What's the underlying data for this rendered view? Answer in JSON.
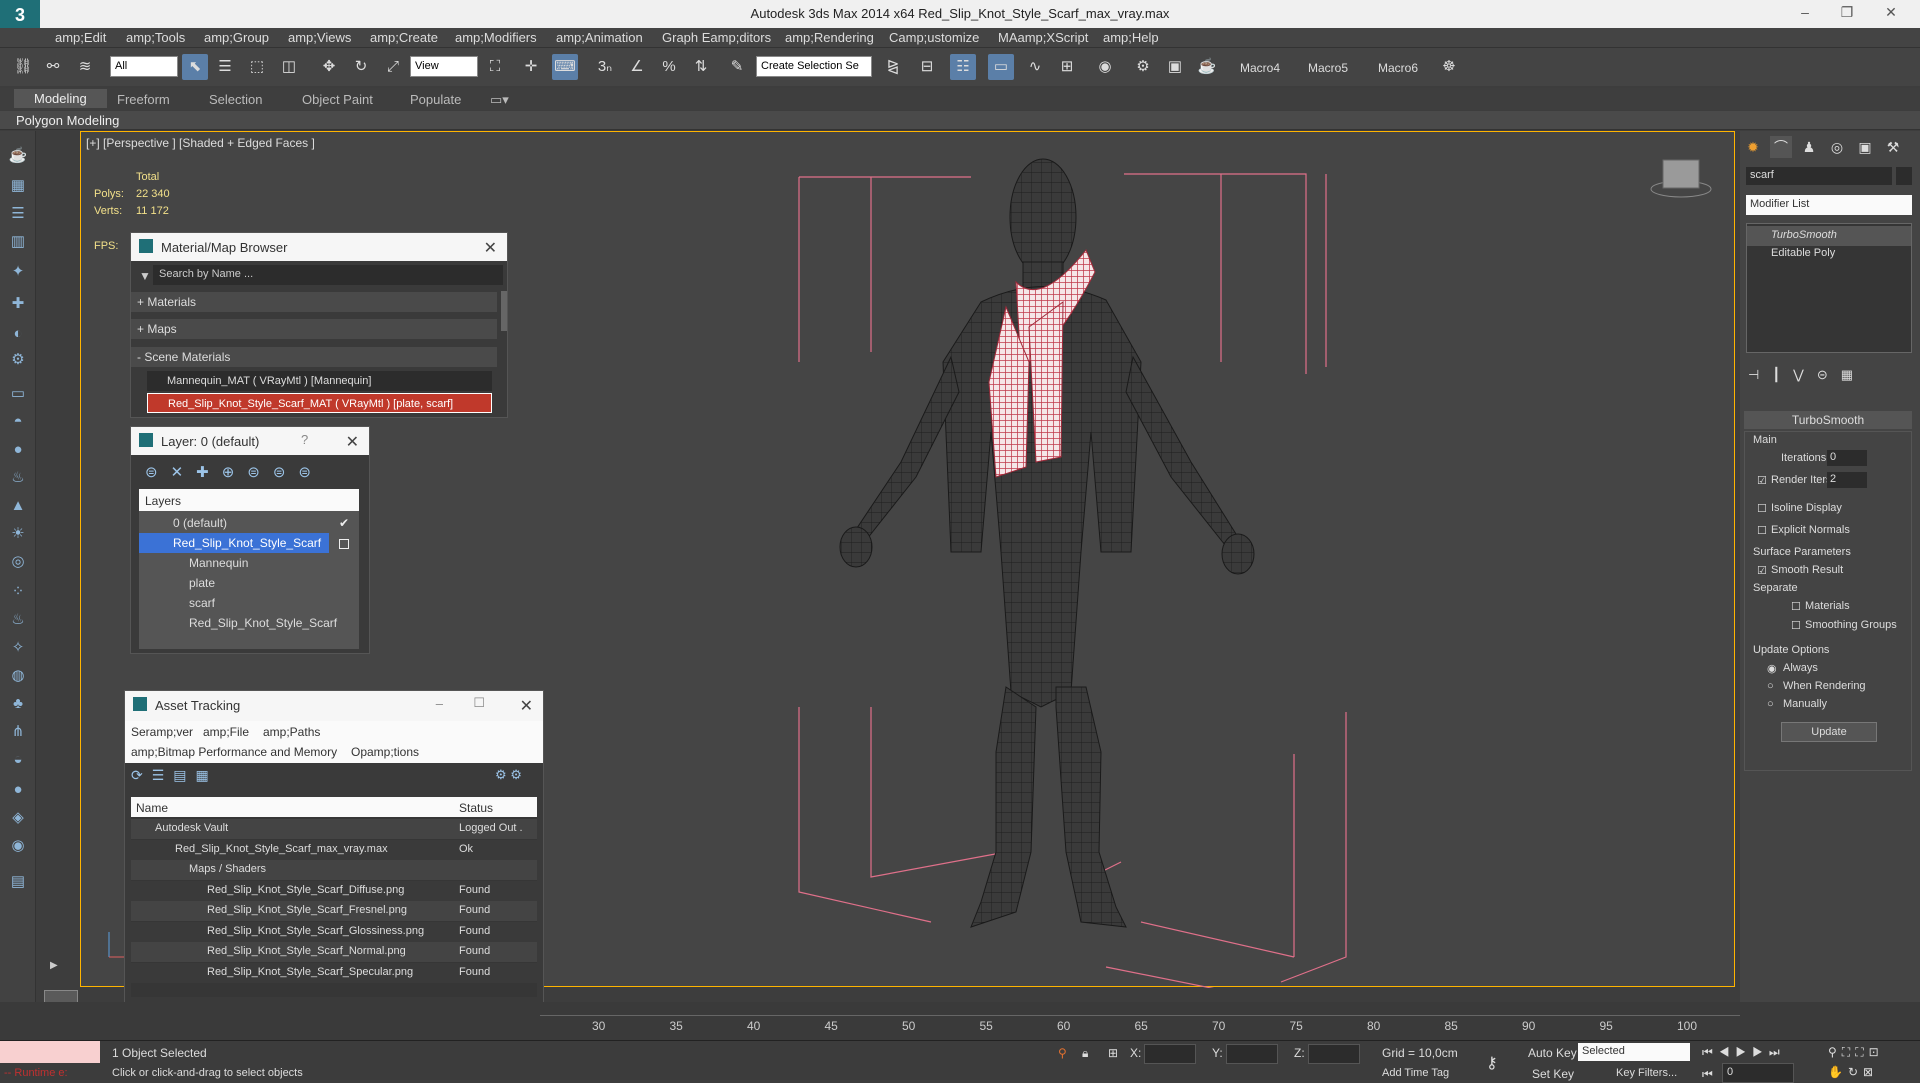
{
  "window": {
    "title": "Autodesk 3ds Max  2014 x64     Red_Slip_Knot_Style_Scarf_max_vray.max",
    "logo": "3"
  },
  "menu": [
    "amp;Edit",
    "amp;Tools",
    "amp;Group",
    "amp;Views",
    "amp;Create",
    "amp;Modifiers",
    "amp;Animation",
    "Graph Eamp;ditors",
    "amp;Rendering",
    "Camp;ustomize",
    "MAamp;XScript",
    "amp;Help"
  ],
  "toolbar": {
    "filter": "All",
    "refcoord": "View",
    "selection_set": "Create Selection Se",
    "macros": [
      "Macro4",
      "Macro5",
      "Macro6"
    ]
  },
  "ribbon": {
    "tabs": [
      "Modeling",
      "Freeform",
      "Selection",
      "Object Paint",
      "Populate"
    ],
    "subtitle": "Polygon Modeling"
  },
  "viewport": {
    "label": "[+] [Perspective ] [Shaded + Edged Faces ]",
    "stats_total": "Total",
    "polys_label": "Polys:",
    "polys_value": "22 340",
    "verts_label": "Verts:",
    "verts_value": "11 172",
    "fps_label": "FPS:"
  },
  "material_browser": {
    "title": "Material/Map Browser",
    "search_placeholder": "Search by Name ...",
    "sections": [
      "+ Materials",
      "+ Maps",
      "- Scene Materials"
    ],
    "materials": [
      "Mannequin_MAT  ( VRayMtl )  [Mannequin]",
      "Red_Slip_Knot_Style_Scarf_MAT  ( VRayMtl )  [plate, scarf]"
    ]
  },
  "layer_dialog": {
    "title": "Layer: 0 (default)",
    "help": "?",
    "header": "Layers",
    "items": [
      "0 (default)",
      "Red_Slip_Knot_Style_Scarf",
      "Mannequin",
      "plate",
      "scarf",
      "Red_Slip_Knot_Style_Scarf"
    ]
  },
  "asset_tracking": {
    "title": "Asset Tracking",
    "menu": [
      "Seramp;ver",
      "amp;File",
      "amp;Paths"
    ],
    "menu2": [
      "amp;Bitmap Performance and Memory",
      "Opamp;tions"
    ],
    "col_name": "Name",
    "col_status": "Status",
    "rows": [
      {
        "name": "Autodesk Vault",
        "status": "Logged Out ."
      },
      {
        "name": "Red_Slip_Knot_Style_Scarf_max_vray.max",
        "status": "Ok"
      },
      {
        "name": "Maps / Shaders",
        "status": ""
      },
      {
        "name": "Red_Slip_Knot_Style_Scarf_Diffuse.png",
        "status": "Found"
      },
      {
        "name": "Red_Slip_Knot_Style_Scarf_Fresnel.png",
        "status": "Found"
      },
      {
        "name": "Red_Slip_Knot_Style_Scarf_Glossiness.png",
        "status": "Found"
      },
      {
        "name": "Red_Slip_Knot_Style_Scarf_Normal.png",
        "status": "Found"
      },
      {
        "name": "Red_Slip_Knot_Style_Scarf_Specular.png",
        "status": "Found"
      }
    ]
  },
  "command_panel": {
    "object_name": "scarf",
    "modifier_list": "Modifier List",
    "stack": [
      "TurboSmooth",
      "Editable Poly"
    ],
    "rollout_title": "TurboSmooth",
    "main_label": "Main",
    "iterations_label": "Iterations:",
    "iterations_value": "0",
    "render_iters_label": "Render Iters:",
    "render_iters_value": "2",
    "isoline": "Isoline Display",
    "explicit": "Explicit Normals",
    "surface_label": "Surface Parameters",
    "smooth_result": "Smooth Result",
    "separate_label": "Separate",
    "materials": "Materials",
    "smoothing_groups": "Smoothing Groups",
    "update_options": "Update Options",
    "always": "Always",
    "when_rendering": "When Rendering",
    "manually": "Manually",
    "update_button": "Update"
  },
  "timeline": {
    "ticks": [
      "30",
      "35",
      "40",
      "45",
      "50",
      "55",
      "60",
      "65",
      "70",
      "75",
      "80",
      "85",
      "90",
      "95",
      "100"
    ]
  },
  "status": {
    "selected": "1 Object Selected",
    "hint": "Click or click-and-drag to select objects",
    "runtime": "-- Runtime e:",
    "x_label": "X:",
    "y_label": "Y:",
    "z_label": "Z:",
    "grid": "Grid = 10,0cm",
    "autokey": "Auto Key",
    "setkey": "Set Key",
    "selected_dropdown": "Selected",
    "add_time_tag": "Add Time Tag",
    "key_filters": "Key Filters...",
    "frame": "0"
  },
  "colors": {
    "accent": "#5b7fa8",
    "viewport_border": "#ffb400",
    "selected_row": "#3b72d6",
    "scarf": "#c0394b",
    "bbox": "#e0708a"
  }
}
